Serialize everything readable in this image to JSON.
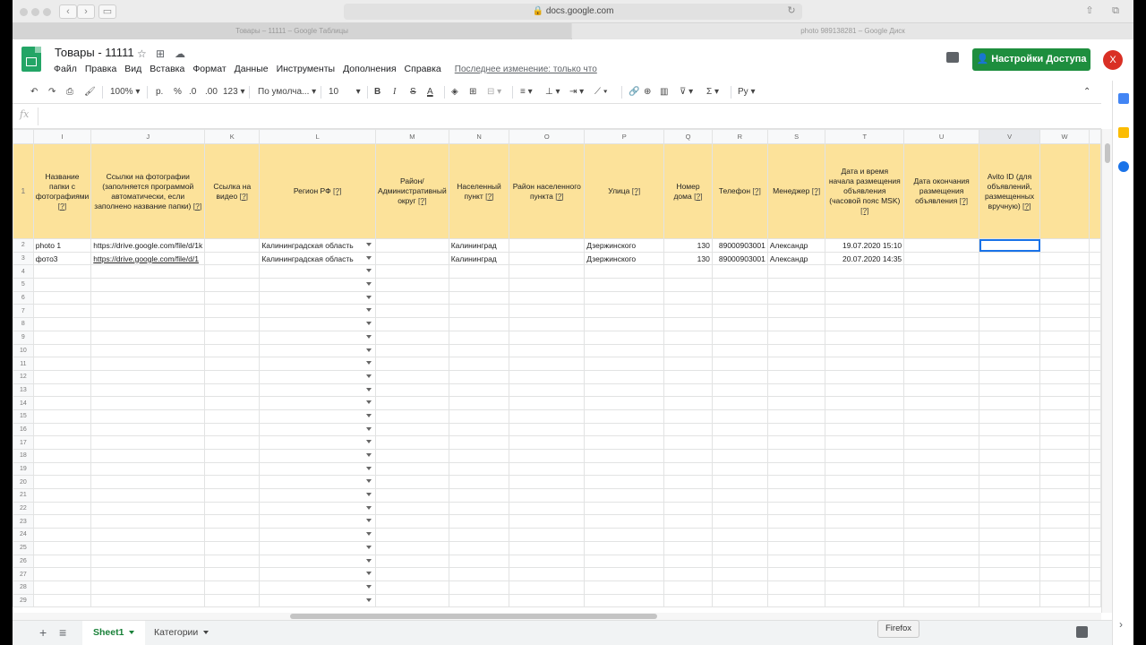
{
  "browser": {
    "address": "docs.google.com",
    "tabs": [
      "Товары – 11111 – Google Таблицы",
      "photo 989138281 – Google Диск"
    ]
  },
  "doc": {
    "title": "Товары - 11111",
    "menu": [
      "Файл",
      "Правка",
      "Вид",
      "Вставка",
      "Формат",
      "Данные",
      "Инструменты",
      "Дополнения",
      "Справка"
    ],
    "last_edit": "Последнее изменение: только что",
    "share_label": "Настройки Доступа",
    "avatar_letter": "X"
  },
  "toolbar": {
    "zoom": "100%",
    "currency": "р.",
    "percent": "%",
    "dec_less": ".0",
    "dec_more": ".00",
    "format_more": "123",
    "font": "По умолча...",
    "font_size": "10",
    "bold": "B",
    "italic": "I",
    "strike": "S",
    "text_color": "A",
    "input_tool": "Ру"
  },
  "formula_bar": {
    "fx": "fx",
    "value": ""
  },
  "grid": {
    "columns": [
      "I",
      "J",
      "K",
      "L",
      "M",
      "N",
      "O",
      "P",
      "Q",
      "R",
      "S",
      "T",
      "U",
      "V",
      "W"
    ],
    "header_row_number": "1",
    "headers": [
      "Название папки с фотографиями",
      "Ссылки на фотографии (заполняется программой автоматически, если заполнено название папки)",
      "Ссылка на видео",
      "Регион РФ",
      "Район/Административный округ",
      "Населенный пункт",
      "Район населенного пункта",
      "Улица",
      "Номер дома",
      "Телефон",
      "Менеджер",
      "Дата и время начала размещения объявления (часовой пояс MSK)",
      "Дата окончания размещения объявления",
      "Avito ID (для объявлений, размещенных вручную)",
      ""
    ],
    "help_marker": "[?]",
    "rows": [
      {
        "num": "2",
        "cells": [
          "photo 1",
          "https://drive.google.com/file/d/1k",
          "",
          "Калининградская область",
          "",
          "Калининград",
          "",
          "Дзержинского",
          "130",
          "89000903001",
          "Александр",
          "19.07.2020 15:10",
          "",
          "",
          ""
        ]
      },
      {
        "num": "3",
        "cells": [
          "фото3",
          "https://drive.google.com/file/d/1",
          "",
          "Калининградская область",
          "",
          "Калининград",
          "",
          "Дзержинского",
          "130",
          "89000903001",
          "Александр",
          "20.07.2020 14:35",
          "",
          "",
          ""
        ]
      }
    ],
    "empty_rows": [
      "4",
      "5",
      "6",
      "7",
      "8",
      "9",
      "10",
      "11",
      "12",
      "13",
      "14",
      "15",
      "16",
      "17",
      "18",
      "19",
      "20",
      "21",
      "22",
      "23",
      "24",
      "25",
      "26",
      "27",
      "28",
      "29"
    ]
  },
  "sheets": {
    "tabs": [
      "Sheet1",
      "Категории"
    ],
    "add_icon": "+",
    "list_icon": "≡"
  },
  "tooltip": "Firefox"
}
